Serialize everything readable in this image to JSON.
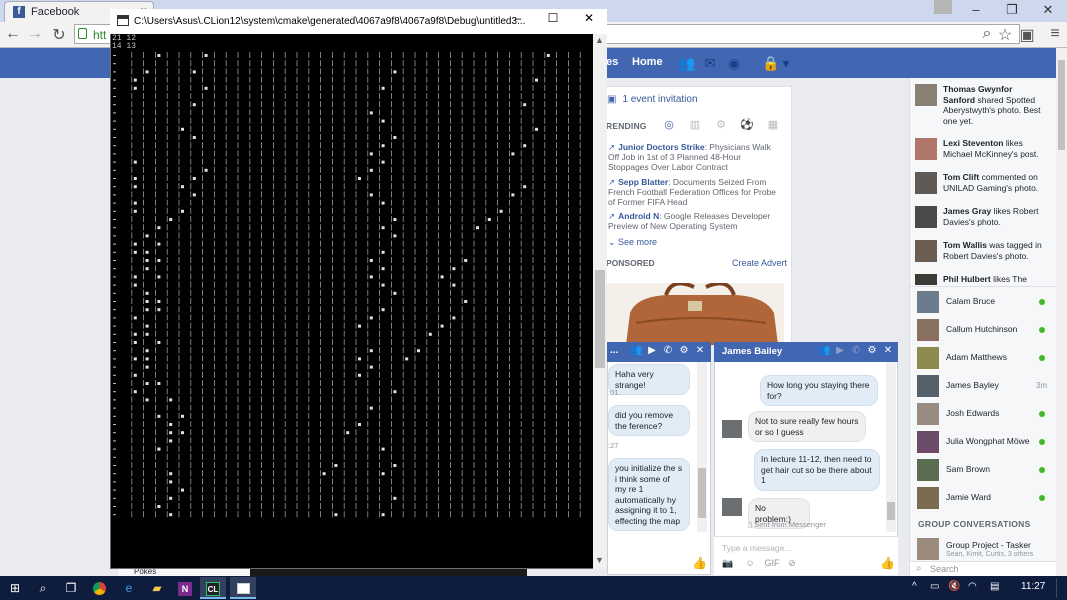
{
  "browser": {
    "tab_title": "Facebook",
    "tab_close": "×",
    "url_partial": "htt"
  },
  "console": {
    "title": "C:\\Users\\Asus\\.CLion12\\system\\cmake\\generated\\4067a9f8\\4067a9f8\\Debug\\untitled3...",
    "lines": [
      "21 12",
      "14 13"
    ]
  },
  "facebook": {
    "nav_fragment": "es",
    "home": "Home",
    "event_invitation": "1 event invitation",
    "trending_label": "RENDING",
    "trending": [
      {
        "title": "Junior Doctors Strike",
        "text": ": Physicians Walk Off Job in 1st of 3 Planned 48-Hour Stoppages Over Labor Contract"
      },
      {
        "title": "Sepp Blatter",
        "text": ": Documents Seized From French Football Federation Offices for Probe of Former FIFA Head"
      },
      {
        "title": "Android N",
        "text": ": Google Releases Developer Preview of New Operating System"
      }
    ],
    "see_more": "See more",
    "sponsored_label": "PONSORED",
    "create_advert": "Create Advert",
    "ticker": [
      {
        "name": "Thomas Gwynfor Sanford",
        "text": " shared Spotted Aberystwyth's photo. Best one yet."
      },
      {
        "name": "Lexi Steventon",
        "text": " likes Michael McKinney's post."
      },
      {
        "name": "Tom Clift",
        "text": " commented on UNILAD Gaming's photo."
      },
      {
        "name": "James Gray",
        "text": " likes Robert Davies's photo."
      },
      {
        "name": "Tom Wallis",
        "text": " was tagged in Robert Davies's photo."
      },
      {
        "name": "Phil Hulbert",
        "text": " likes The"
      }
    ],
    "contacts": [
      {
        "name": "Calam Bruce",
        "status": ""
      },
      {
        "name": "Callum Hutchinson",
        "status": ""
      },
      {
        "name": "Adam Matthews",
        "status": ""
      },
      {
        "name": "James Bayley",
        "status": "3m"
      },
      {
        "name": "Josh Edwards",
        "status": ""
      },
      {
        "name": "Julia Wongphat Möwe",
        "status": ""
      },
      {
        "name": "Sam Brown",
        "status": ""
      },
      {
        "name": "Jamie Ward",
        "status": ""
      }
    ],
    "group_conversations_label": "GROUP CONVERSATIONS",
    "group": {
      "name": "Group Project - Tasker",
      "members": "Sean, Kimit, Curtis, 3 others"
    },
    "search_placeholder": "Search",
    "pokes": "Pokes"
  },
  "chat1": {
    "title": "...",
    "messages": [
      {
        "kind": "out",
        "text": "Haha very strange!"
      },
      {
        "kind": "stamp",
        "text": ":01"
      },
      {
        "kind": "out",
        "text": "did you remove the ference?"
      },
      {
        "kind": "stamp",
        "text": ":27"
      },
      {
        "kind": "out",
        "text": "you initialize the s i think some of my re 1 automatically hy assigning it to 1, effecting the map"
      }
    ]
  },
  "chat2": {
    "title": "James Bailey",
    "messages": [
      {
        "kind": "out",
        "text": "How long you staying there for?"
      },
      {
        "kind": "in",
        "text": "Not to sure really few hours or so I guess"
      },
      {
        "kind": "out",
        "text": "In lecture 11-12, then need to get hair cut so be there about 1"
      },
      {
        "kind": "in",
        "text": "No problem:)"
      }
    ],
    "sent_from": "Sent from Messenger",
    "input_placeholder": "Type a message...",
    "gif_label": "GIF"
  },
  "taskbar": {
    "time": "11:27",
    "apps": [
      "start",
      "search",
      "task-view",
      "chrome",
      "edge",
      "file-explorer",
      "onenote",
      "clion",
      "console"
    ]
  },
  "colors": {
    "facebook_blue": "#4267b2",
    "online_green": "#42b72a",
    "taskbar": "#0e1c3d"
  }
}
